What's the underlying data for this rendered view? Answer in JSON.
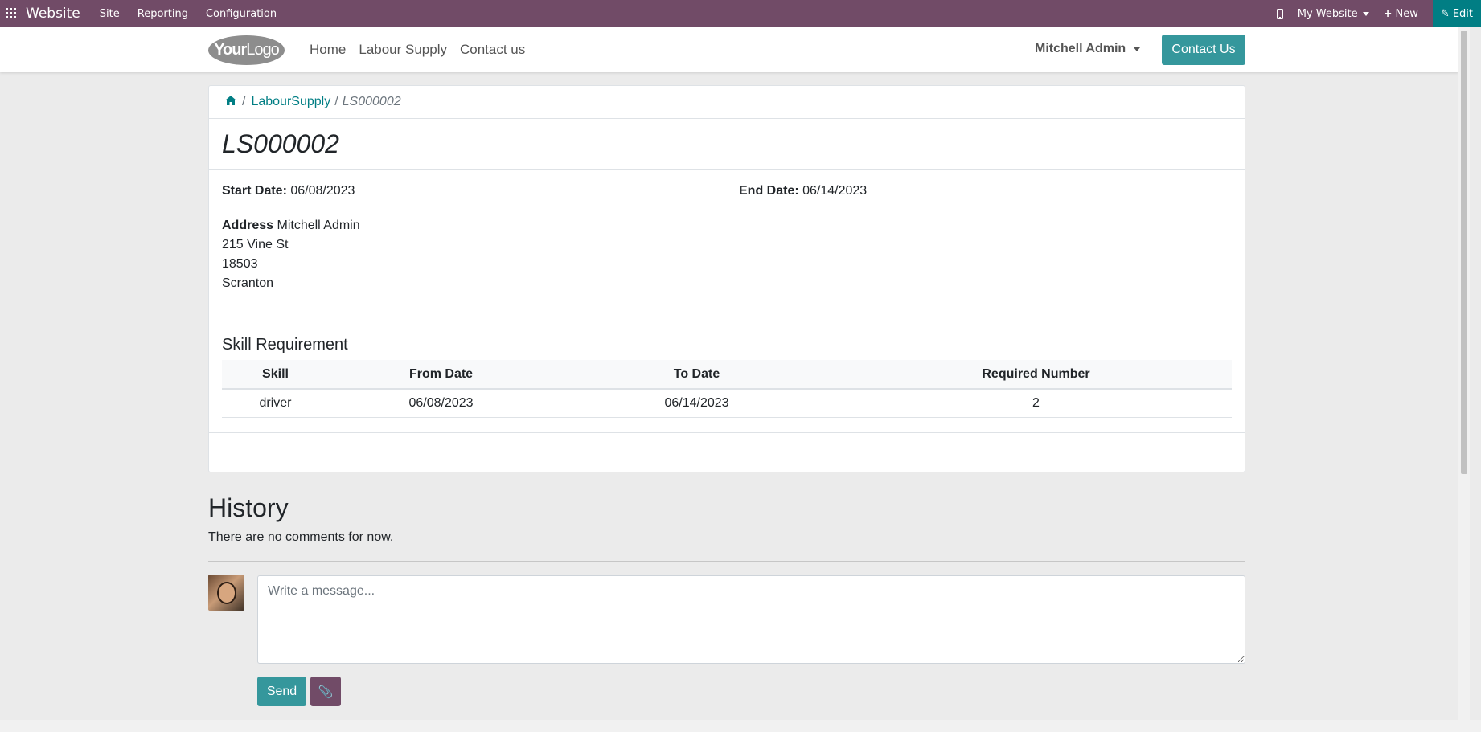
{
  "topbar": {
    "brand": "Website",
    "menus": [
      "Site",
      "Reporting",
      "Configuration"
    ],
    "website_selector": "My Website",
    "new_label": "New",
    "edit_label": "Edit"
  },
  "header": {
    "logo_text_bold": "Your",
    "logo_text_light": "Logo",
    "nav": [
      "Home",
      "Labour Supply",
      "Contact us"
    ],
    "user_name": "Mitchell Admin",
    "contact_button": "Contact Us"
  },
  "breadcrumb": {
    "parent": "LabourSupply",
    "current": "LS000002"
  },
  "record": {
    "title": "LS000002",
    "start_label": "Start Date:",
    "start_value": "06/08/2023",
    "end_label": "End Date:",
    "end_value": "06/14/2023",
    "address_label": "Address",
    "address_lines": [
      "Mitchell Admin",
      "215 Vine St",
      "18503",
      "Scranton"
    ]
  },
  "skills": {
    "heading": "Skill Requirement",
    "columns": [
      "Skill",
      "From Date",
      "To Date",
      "Required Number"
    ],
    "rows": [
      [
        "driver",
        "06/08/2023",
        "06/14/2023",
        "2"
      ]
    ]
  },
  "history": {
    "heading": "History",
    "empty_text": "There are no comments for now.",
    "message_placeholder": "Write a message...",
    "send_label": "Send"
  },
  "colors": {
    "topbar": "#714b67",
    "accent": "#35979c",
    "edit": "#017e84"
  }
}
